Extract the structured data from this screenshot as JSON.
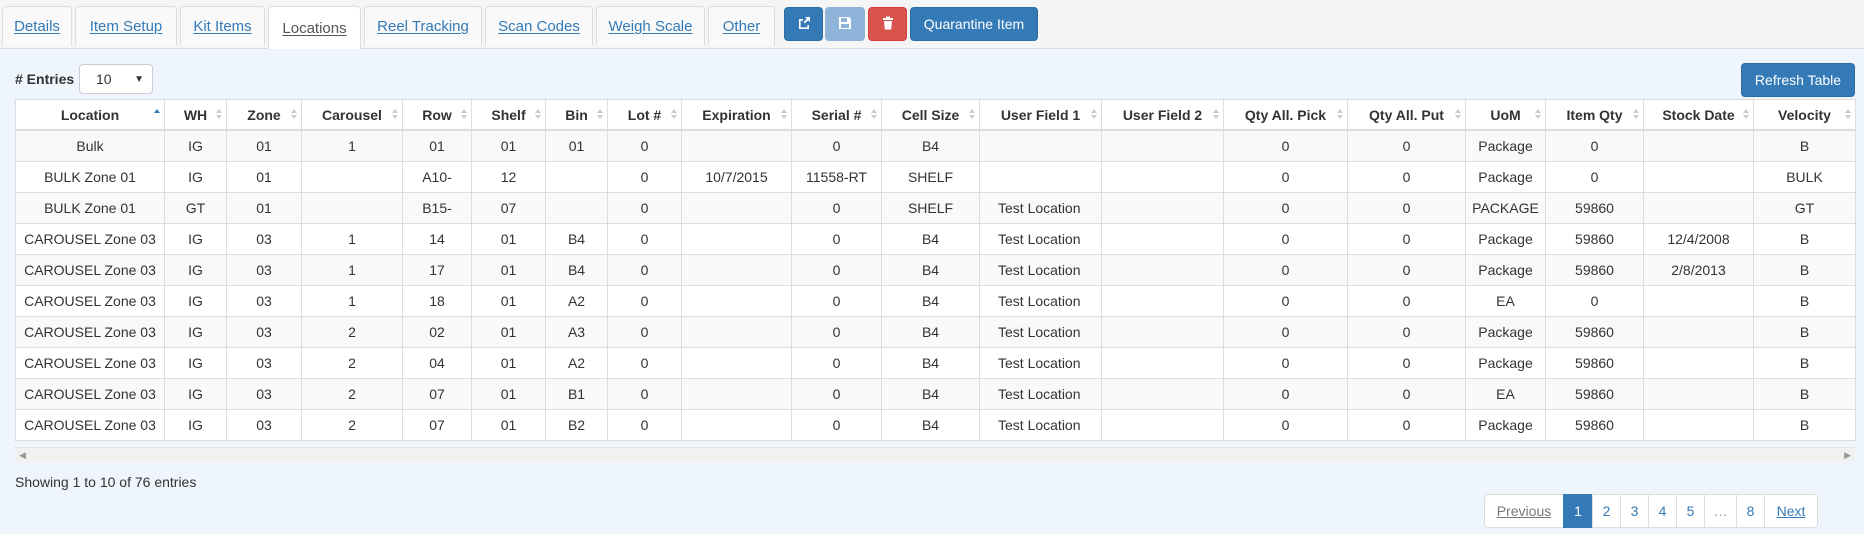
{
  "tabs": [
    {
      "label": "Details",
      "active": false
    },
    {
      "label": "Item Setup",
      "active": false
    },
    {
      "label": "Kit Items",
      "active": false
    },
    {
      "label": "Locations",
      "active": true
    },
    {
      "label": "Reel Tracking",
      "active": false
    },
    {
      "label": "Scan Codes",
      "active": false
    },
    {
      "label": "Weigh Scale",
      "active": false
    },
    {
      "label": "Other",
      "active": false
    }
  ],
  "toolbar": {
    "export_icon": "share-square-icon",
    "save_icon": "floppy-disk-icon",
    "delete_icon": "trash-icon",
    "quarantine_label": "Quarantine Item"
  },
  "controls": {
    "entries_label": "# Entries",
    "entries_value": "10",
    "refresh_label": "Refresh Table"
  },
  "table": {
    "columns": [
      "Location",
      "WH",
      "Zone",
      "Carousel",
      "Row",
      "Shelf",
      "Bin",
      "Lot #",
      "Expiration",
      "Serial #",
      "Cell Size",
      "User Field 1",
      "User Field 2",
      "Qty All. Pick",
      "Qty All. Put",
      "UoM",
      "Item Qty",
      "Stock Date",
      "Velocity"
    ],
    "sorted_column": "Location",
    "sort_direction": "ascending",
    "rows": [
      [
        "Bulk",
        "IG",
        "01",
        "1",
        "01",
        "01",
        "01",
        "0",
        "",
        "0",
        "B4",
        "",
        "",
        "0",
        "0",
        "Package",
        "0",
        "",
        "B"
      ],
      [
        "BULK Zone 01",
        "IG",
        "01",
        "",
        "A10-",
        "12",
        "",
        "0",
        "10/7/2015",
        "11558-RT",
        "SHELF",
        "",
        "",
        "0",
        "0",
        "Package",
        "0",
        "",
        "BULK"
      ],
      [
        "BULK Zone 01",
        "GT",
        "01",
        "",
        "B15-",
        "07",
        "",
        "0",
        "",
        "0",
        "SHELF",
        "Test Location",
        "",
        "0",
        "0",
        "PACKAGE",
        "59860",
        "",
        "GT"
      ],
      [
        "CAROUSEL Zone 03",
        "IG",
        "03",
        "1",
        "14",
        "01",
        "B4",
        "0",
        "",
        "0",
        "B4",
        "Test Location",
        "",
        "0",
        "0",
        "Package",
        "59860",
        "12/4/2008",
        "B"
      ],
      [
        "CAROUSEL Zone 03",
        "IG",
        "03",
        "1",
        "17",
        "01",
        "B4",
        "0",
        "",
        "0",
        "B4",
        "Test Location",
        "",
        "0",
        "0",
        "Package",
        "59860",
        "2/8/2013",
        "B"
      ],
      [
        "CAROUSEL Zone 03",
        "IG",
        "03",
        "1",
        "18",
        "01",
        "A2",
        "0",
        "",
        "0",
        "B4",
        "Test Location",
        "",
        "0",
        "0",
        "EA",
        "0",
        "",
        "B"
      ],
      [
        "CAROUSEL Zone 03",
        "IG",
        "03",
        "2",
        "02",
        "01",
        "A3",
        "0",
        "",
        "0",
        "B4",
        "Test Location",
        "",
        "0",
        "0",
        "Package",
        "59860",
        "",
        "B"
      ],
      [
        "CAROUSEL Zone 03",
        "IG",
        "03",
        "2",
        "04",
        "01",
        "A2",
        "0",
        "",
        "0",
        "B4",
        "Test Location",
        "",
        "0",
        "0",
        "Package",
        "59860",
        "",
        "B"
      ],
      [
        "CAROUSEL Zone 03",
        "IG",
        "03",
        "2",
        "07",
        "01",
        "B1",
        "0",
        "",
        "0",
        "B4",
        "Test Location",
        "",
        "0",
        "0",
        "EA",
        "59860",
        "",
        "B"
      ],
      [
        "CAROUSEL Zone 03",
        "IG",
        "03",
        "2",
        "07",
        "01",
        "B2",
        "0",
        "",
        "0",
        "B4",
        "Test Location",
        "",
        "0",
        "0",
        "Package",
        "59860",
        "",
        "B"
      ]
    ]
  },
  "footer": {
    "info": "Showing 1 to 10 of 76 entries",
    "previous": "Previous",
    "pages": [
      "1",
      "2",
      "3",
      "4",
      "5",
      "…",
      "8"
    ],
    "current_page": "1",
    "next": "Next"
  },
  "colors": {
    "primary": "#337ab7",
    "primary_disabled": "#8fb4d9",
    "danger": "#d9534f"
  }
}
